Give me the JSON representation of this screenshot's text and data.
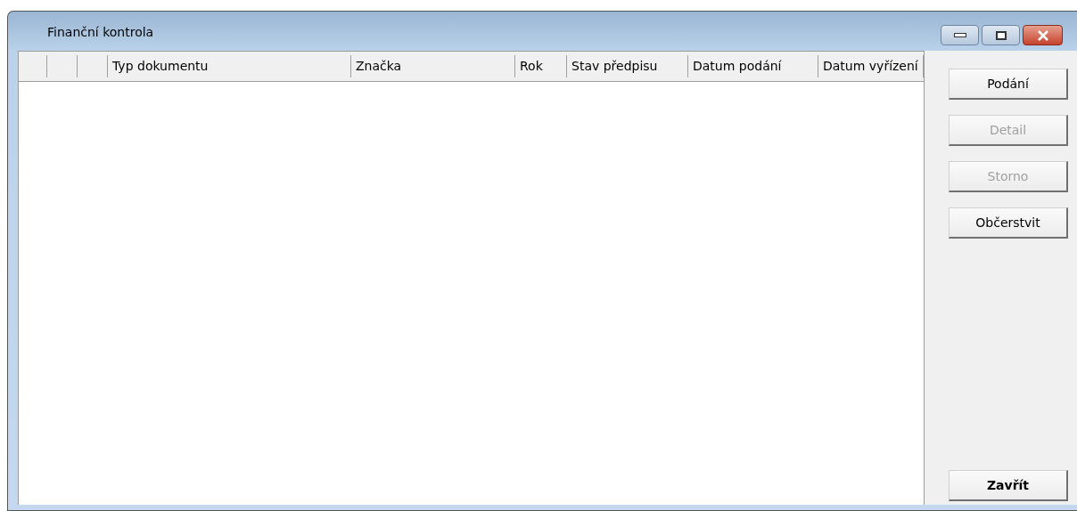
{
  "window": {
    "title": "Finanční kontrola"
  },
  "table": {
    "columns": [
      {},
      {},
      {},
      {
        "label": "Typ dokumentu"
      },
      {
        "label": "Značka"
      },
      {
        "label": "Rok"
      },
      {
        "label": "Stav předpisu"
      },
      {
        "label": "Datum podání"
      },
      {
        "label": "Datum vyřízení"
      }
    ]
  },
  "buttons": [
    {
      "label": "Podání",
      "disabled": false,
      "default": false
    },
    {
      "label": "Detail",
      "disabled": true,
      "default": false
    },
    {
      "label": "Storno",
      "disabled": true,
      "default": false
    },
    {
      "label": "Občerstvit",
      "disabled": false,
      "default": false
    },
    {
      "label": "Zavřít",
      "disabled": false,
      "default": true
    }
  ]
}
